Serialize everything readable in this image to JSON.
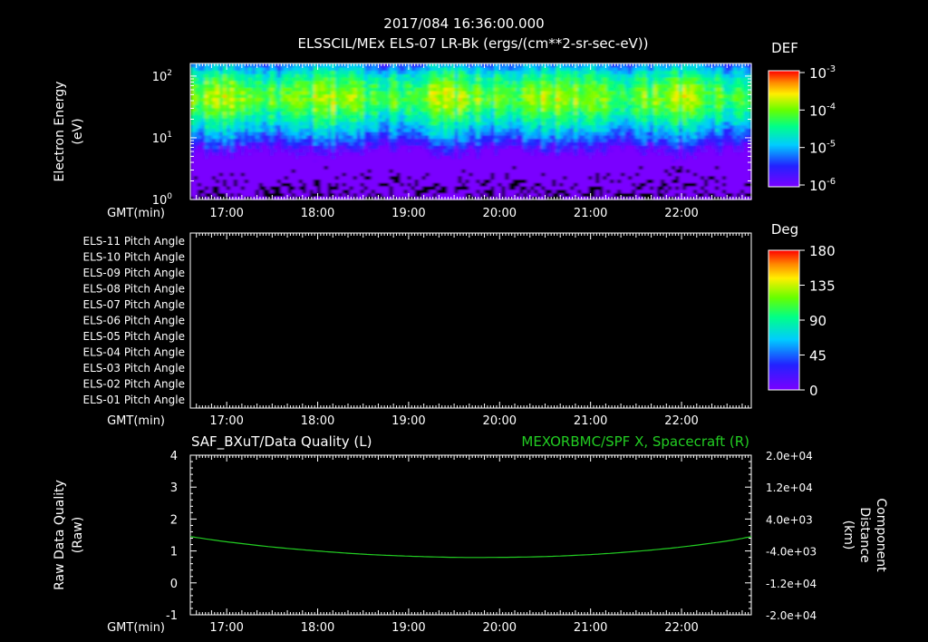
{
  "header": {
    "timestamp": "2017/084 16:36:00.000",
    "subtitle": "ELSSCIL/MEx ELS-07 LR-Bk  (ergs/(cm**2-sr-sec-eV))"
  },
  "colors": {
    "background": "#000000",
    "axis": "#ffffff",
    "right_series": "#22cc22"
  },
  "chart_data": [
    {
      "type": "heatmap",
      "ylabel_line1": "Electron Energy",
      "ylabel_line2": "(eV)",
      "x_axis_label": "GMT(min)",
      "x_ticks": [
        "17:00",
        "18:00",
        "19:00",
        "20:00",
        "21:00",
        "22:00"
      ],
      "y_scale": "log",
      "y_ticks": [
        {
          "base": "10",
          "exp": "0"
        },
        {
          "base": "10",
          "exp": "1"
        },
        {
          "base": "10",
          "exp": "2"
        }
      ],
      "xlim_min": [
        996,
        1366
      ],
      "ylim_eV": [
        1,
        160
      ],
      "colorbar": {
        "title": "DEF",
        "scale": "log",
        "ticks": [
          {
            "base": "10",
            "exp": "-3"
          },
          {
            "base": "10",
            "exp": "-4"
          },
          {
            "base": "10",
            "exp": "-5"
          },
          {
            "base": "10",
            "exp": "-6"
          }
        ]
      },
      "peak_energy_eV_approx": 40,
      "high_flux_band_eV": [
        15,
        120
      ]
    },
    {
      "type": "heatmap",
      "x_axis_label": "GMT(min)",
      "x_ticks": [
        "17:00",
        "18:00",
        "19:00",
        "20:00",
        "21:00",
        "22:00"
      ],
      "row_labels": [
        "ELS-11 Pitch Angle",
        "ELS-10 Pitch Angle",
        "ELS-09 Pitch Angle",
        "ELS-08 Pitch Angle",
        "ELS-07 Pitch Angle",
        "ELS-06 Pitch Angle",
        "ELS-05 Pitch Angle",
        "ELS-04 Pitch Angle",
        "ELS-03 Pitch Angle",
        "ELS-02 Pitch Angle",
        "ELS-01 Pitch Angle"
      ],
      "colorbar": {
        "title": "Deg",
        "ticks": [
          "180",
          "135",
          "90",
          "45",
          "0"
        ]
      },
      "values": []
    },
    {
      "type": "line",
      "left_title": "SAF_BXuT/Data Quality (L)",
      "right_title": "MEXORBMC/SPF X, Spacecraft (R)",
      "ylabel_line1": "Raw Data Quality",
      "ylabel_line2": "(Raw)",
      "right_label_line1": "Component",
      "right_label_line2": "Distance",
      "right_label_line3": "(km)",
      "x_axis_label": "GMT(min)",
      "x_ticks": [
        "17:00",
        "18:00",
        "19:00",
        "20:00",
        "21:00",
        "22:00"
      ],
      "y_ticks": [
        "4",
        "3",
        "2",
        "1",
        "0",
        "-1"
      ],
      "ylim": [
        -1,
        4
      ],
      "right_ticks": [
        "2.0e+04",
        "1.2e+04",
        "4.0e+03",
        "-4.0e+03",
        "-1.2e+04",
        "-2.0e+04"
      ],
      "right_ylim": [
        -20000,
        20000
      ],
      "series": [
        {
          "name": "MEXORBMC/SPF X, Spacecraft (R)",
          "x": [
            "16:36",
            "17:00",
            "17:30",
            "18:00",
            "18:30",
            "19:00",
            "19:30",
            "20:00",
            "20:30",
            "21:00",
            "21:30",
            "22:00",
            "22:30",
            "22:46"
          ],
          "values": [
            -400,
            -1700,
            -3000,
            -4000,
            -4800,
            -5300,
            -5600,
            -5600,
            -5400,
            -4900,
            -4100,
            -3000,
            -1500,
            -400
          ]
        }
      ]
    }
  ]
}
